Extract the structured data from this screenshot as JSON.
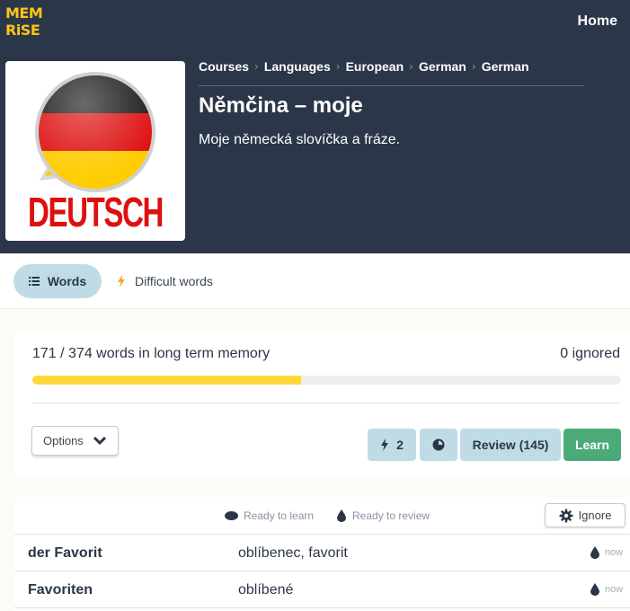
{
  "brand": {
    "logo_line1": "MEM",
    "logo_line2": "RiSE",
    "accent": "#ffc31a"
  },
  "nav": {
    "home_label": "Home"
  },
  "course": {
    "breadcrumb": [
      "Courses",
      "Languages",
      "European",
      "German",
      "German"
    ],
    "title": "Němčina – moje",
    "description": "Moje německá slovíčka a fráze.",
    "image": {
      "flag_colors": [
        "#1a1a1a",
        "#dd1010",
        "#ffcc00"
      ],
      "caption": "DEUTSCH"
    }
  },
  "tabs": [
    {
      "label": "Words",
      "icon": "list-icon",
      "active": true
    },
    {
      "label": "Difficult words",
      "icon": "lightning-icon",
      "active": false
    }
  ],
  "progress": {
    "memory_text": "171 / 374 words in long term memory",
    "ignored_text": "0 ignored",
    "learned": 171,
    "total": 374,
    "bar_color": "#ffd83a"
  },
  "controls": {
    "options_label": "Options",
    "speed_review_count": "2",
    "review_label": "Review (145)",
    "learn_label": "Learn"
  },
  "word_list": {
    "legend_learn": "Ready to learn",
    "legend_review": "Ready to review",
    "ignore_label": "Ignore",
    "rows": [
      {
        "word": "der Favorit",
        "definition": "oblíbenec, favorit",
        "due": "now"
      },
      {
        "word": "Favoriten",
        "definition": "oblíbené",
        "due": "now"
      }
    ]
  }
}
